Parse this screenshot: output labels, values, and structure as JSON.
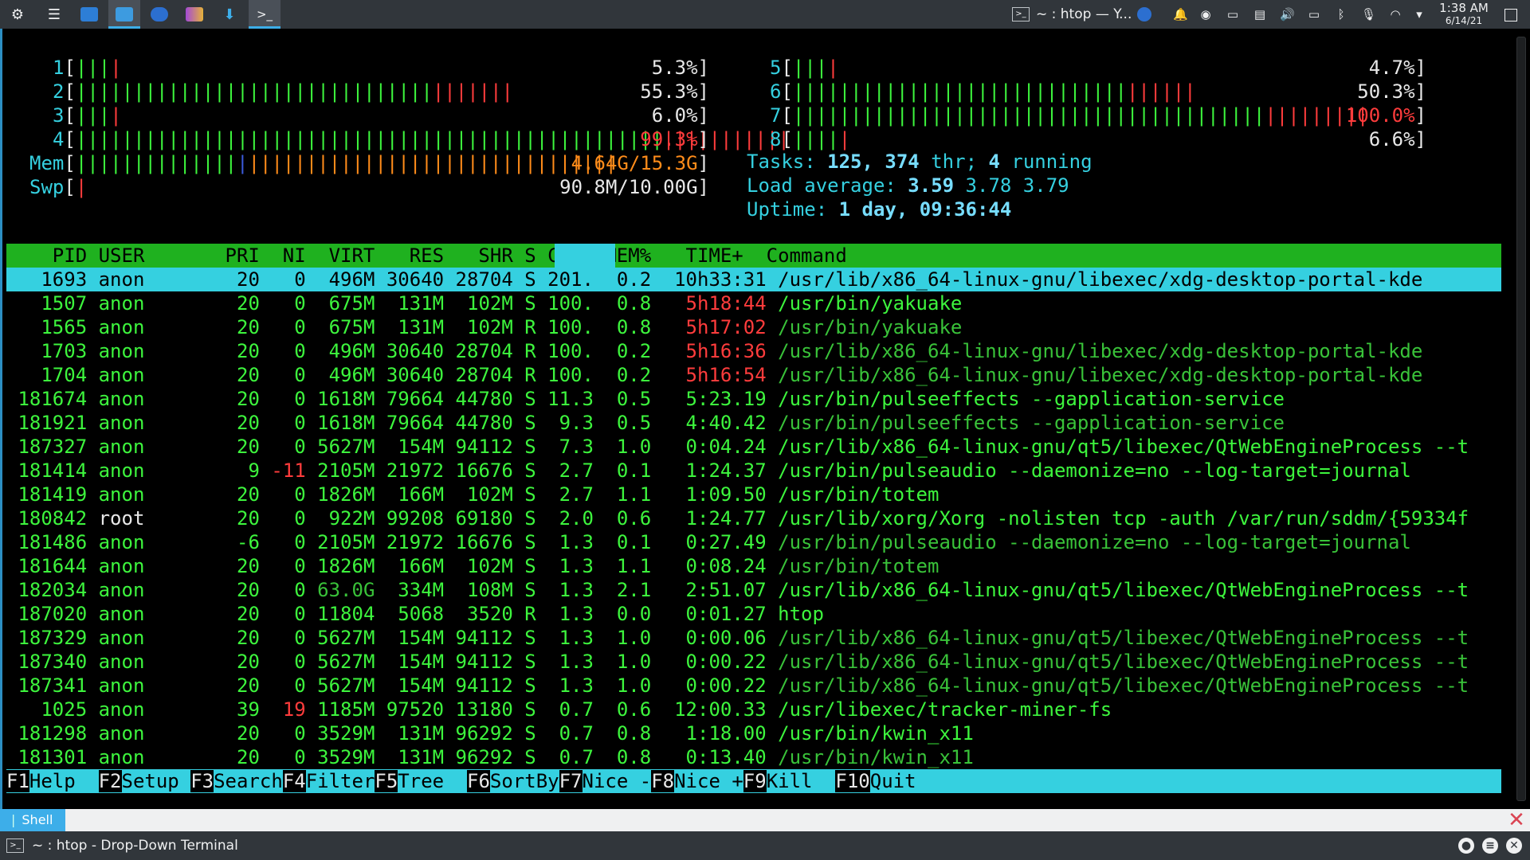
{
  "panel": {
    "task_title": "~ : htop — Y...",
    "clock_time": "1:38 AM",
    "clock_date": "6/14/21",
    "launchers": [
      "kde-menu-icon",
      "task-manager-icon",
      "store-icon",
      "dolphin-icon",
      "chromium-icon",
      "kdenlive-icon",
      "downloader-icon",
      "terminal-icon"
    ]
  },
  "htop": {
    "cpus_left": [
      {
        "num": "1",
        "bar": "||||",
        "pct": "5.3%]",
        "fill": 0.053
      },
      {
        "num": "2",
        "bar": "||||||||||||||||||||||||||||||||||||||",
        "pct": "55.3%]",
        "fill": 0.553
      },
      {
        "num": "3",
        "bar": "||||",
        "pct": "6.0%]",
        "fill": 0.06
      },
      {
        "num": "4",
        "bar": "||||||||||||||||||||||||||||||||||||||||||||||||||||||||||||||",
        "pct": "99.3%]",
        "fill": 0.993
      }
    ],
    "cpus_right": [
      {
        "num": "5",
        "bar": "||||",
        "pct": "4.7%]",
        "fill": 0.047
      },
      {
        "num": "6",
        "bar": "|||||||||||||||||||||||||||||||||||",
        "pct": "50.3%]",
        "fill": 0.503
      },
      {
        "num": "7",
        "bar": "||||||||||||||||||||||||||||||||||||||||||||||||||",
        "pct": "100.0%]",
        "fill": 1.0
      },
      {
        "num": "8",
        "bar": "|||||",
        "pct": "6.6%]",
        "fill": 0.066
      }
    ],
    "mem": {
      "label": "Mem[",
      "used": "4.64G/",
      "total": "15.3G]"
    },
    "swp": {
      "label": "Swp[",
      "value": "90.8M/10.00G]"
    },
    "tasks": {
      "label": "Tasks: ",
      "count": "125, ",
      "threads": "374",
      "thr": " thr; ",
      "running": "4",
      "running_label": " running"
    },
    "load": {
      "label": "Load average: ",
      "l1": "3.59 ",
      "l5": "3.78 ",
      "l15": "3.79"
    },
    "uptime": {
      "label": "Uptime: ",
      "value": "1 day, 09:36:44"
    },
    "header": "    PID USER       PRI  NI  VIRT   RES   SHR S CPU% MEM%   TIME+  Command",
    "rows": [
      [
        "1693",
        "anon",
        "20",
        "0",
        "496M",
        "30640",
        "28704",
        "S",
        "201.",
        "0.2",
        "10h33:31",
        "/usr/lib/x86_64-linux-gnu/libexec/xdg-desktop-portal-kde"
      ],
      [
        "1507",
        "anon",
        "20",
        "0",
        "675M",
        "131M",
        "102M",
        "S",
        "100.",
        "0.8",
        "5h18:44",
        "/usr/bin/yakuake"
      ],
      [
        "1565",
        "anon",
        "20",
        "0",
        "675M",
        "131M",
        "102M",
        "R",
        "100.",
        "0.8",
        "5h17:02",
        "/usr/bin/yakuake"
      ],
      [
        "1703",
        "anon",
        "20",
        "0",
        "496M",
        "30640",
        "28704",
        "R",
        "100.",
        "0.2",
        "5h16:36",
        "/usr/lib/x86_64-linux-gnu/libexec/xdg-desktop-portal-kde"
      ],
      [
        "1704",
        "anon",
        "20",
        "0",
        "496M",
        "30640",
        "28704",
        "R",
        "100.",
        "0.2",
        "5h16:54",
        "/usr/lib/x86_64-linux-gnu/libexec/xdg-desktop-portal-kde"
      ],
      [
        "181674",
        "anon",
        "20",
        "0",
        "1618M",
        "79664",
        "44780",
        "S",
        "11.3",
        "0.5",
        "5:23.19",
        "/usr/bin/pulseeffects --gapplication-service"
      ],
      [
        "181921",
        "anon",
        "20",
        "0",
        "1618M",
        "79664",
        "44780",
        "S",
        "9.3",
        "0.5",
        "4:40.42",
        "/usr/bin/pulseeffects --gapplication-service"
      ],
      [
        "187327",
        "anon",
        "20",
        "0",
        "5627M",
        "154M",
        "94112",
        "S",
        "7.3",
        "1.0",
        "0:04.24",
        "/usr/lib/x86_64-linux-gnu/qt5/libexec/QtWebEngineProcess --t"
      ],
      [
        "181414",
        "anon",
        "9",
        "-11",
        "2105M",
        "21972",
        "16676",
        "S",
        "2.7",
        "0.1",
        "1:24.37",
        "/usr/bin/pulseaudio --daemonize=no --log-target=journal"
      ],
      [
        "181419",
        "anon",
        "20",
        "0",
        "1826M",
        "166M",
        "102M",
        "S",
        "2.7",
        "1.1",
        "1:09.50",
        "/usr/bin/totem"
      ],
      [
        "180842",
        "root",
        "20",
        "0",
        "922M",
        "99208",
        "69180",
        "S",
        "2.0",
        "0.6",
        "1:24.77",
        "/usr/lib/xorg/Xorg -nolisten tcp -auth /var/run/sddm/{59334f"
      ],
      [
        "181486",
        "anon",
        "-6",
        "0",
        "2105M",
        "21972",
        "16676",
        "S",
        "1.3",
        "0.1",
        "0:27.49",
        "/usr/bin/pulseaudio --daemonize=no --log-target=journal"
      ],
      [
        "181644",
        "anon",
        "20",
        "0",
        "1826M",
        "166M",
        "102M",
        "S",
        "1.3",
        "1.1",
        "0:08.24",
        "/usr/bin/totem"
      ],
      [
        "182034",
        "anon",
        "20",
        "0",
        "63.0G",
        "334M",
        "108M",
        "S",
        "1.3",
        "2.1",
        "2:51.07",
        "/usr/lib/x86_64-linux-gnu/qt5/libexec/QtWebEngineProcess --t"
      ],
      [
        "187020",
        "anon",
        "20",
        "0",
        "11804",
        "5068",
        "3520",
        "R",
        "1.3",
        "0.0",
        "0:01.27",
        "htop"
      ],
      [
        "187329",
        "anon",
        "20",
        "0",
        "5627M",
        "154M",
        "94112",
        "S",
        "1.3",
        "1.0",
        "0:00.06",
        "/usr/lib/x86_64-linux-gnu/qt5/libexec/QtWebEngineProcess --t"
      ],
      [
        "187340",
        "anon",
        "20",
        "0",
        "5627M",
        "154M",
        "94112",
        "S",
        "1.3",
        "1.0",
        "0:00.22",
        "/usr/lib/x86_64-linux-gnu/qt5/libexec/QtWebEngineProcess --t"
      ],
      [
        "187341",
        "anon",
        "20",
        "0",
        "5627M",
        "154M",
        "94112",
        "S",
        "1.3",
        "1.0",
        "0:00.22",
        "/usr/lib/x86_64-linux-gnu/qt5/libexec/QtWebEngineProcess --t"
      ],
      [
        "1025",
        "anon",
        "39",
        "19",
        "1185M",
        "97520",
        "13180",
        "S",
        "0.7",
        "0.6",
        "12:00.33",
        "/usr/libexec/tracker-miner-fs"
      ],
      [
        "181298",
        "anon",
        "20",
        "0",
        "3529M",
        "131M",
        "96292",
        "S",
        "0.7",
        "0.8",
        "1:18.00",
        "/usr/bin/kwin_x11"
      ],
      [
        "181301",
        "anon",
        "20",
        "0",
        "3529M",
        "131M",
        "96292",
        "S",
        "0.7",
        "0.8",
        "0:13.40",
        "/usr/bin/kwin_x11"
      ]
    ],
    "thread_rows": [
      2,
      3,
      4,
      6,
      11,
      12,
      15,
      16,
      17,
      20
    ],
    "fkeys": [
      {
        "k": "F1",
        "l": "Help  "
      },
      {
        "k": "F2",
        "l": "Setup "
      },
      {
        "k": "F3",
        "l": "Search"
      },
      {
        "k": "F4",
        "l": "Filter"
      },
      {
        "k": "F5",
        "l": "Tree  "
      },
      {
        "k": "F6",
        "l": "SortBy"
      },
      {
        "k": "F7",
        "l": "Nice -"
      },
      {
        "k": "F8",
        "l": "Nice +"
      },
      {
        "k": "F9",
        "l": "Kill  "
      },
      {
        "k": "F10",
        "l": "Quit"
      }
    ]
  },
  "yakuake": {
    "tab_label": "Shell",
    "window_title": "~ : htop - Drop-Down Terminal"
  },
  "colors": {
    "bar_green": "#3df53d",
    "bar_red": "#ff3c3c",
    "header_bg": "#1fb11f",
    "select_bg": "#35d0e0",
    "accent": "#3daee9"
  }
}
